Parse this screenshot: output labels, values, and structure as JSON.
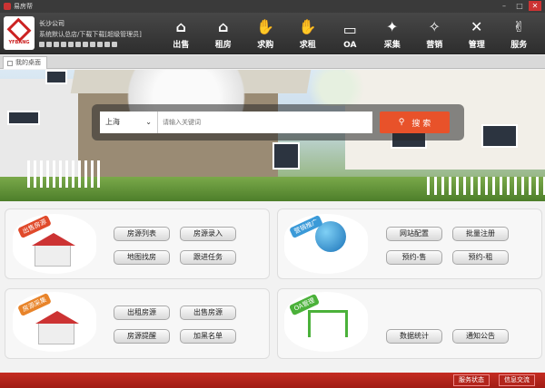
{
  "window": {
    "title": "易房帮",
    "controls": [
      "–",
      "□",
      "✕"
    ]
  },
  "brand": {
    "logo_text": "YFBANG"
  },
  "company": {
    "name": "长沙公司",
    "role": "系统默认总店/下载下载[超级管理员]"
  },
  "nav": [
    {
      "label": "出售",
      "icon": "sale-house-icon"
    },
    {
      "label": "租房",
      "icon": "rent-house-icon"
    },
    {
      "label": "求购",
      "icon": "buy-request-icon"
    },
    {
      "label": "求租",
      "icon": "rent-request-icon"
    },
    {
      "label": "OA",
      "icon": "folder-icon"
    },
    {
      "label": "采集",
      "icon": "magic-wand-icon"
    },
    {
      "label": "营销",
      "icon": "bird-icon"
    },
    {
      "label": "管理",
      "icon": "tools-icon"
    },
    {
      "label": "服务",
      "icon": "handshake-icon"
    }
  ],
  "tabs": [
    {
      "label": "我的桌面"
    }
  ],
  "search": {
    "city": "上海",
    "placeholder": "请输入关键词",
    "button": "搜 索"
  },
  "panels": {
    "sale": {
      "flag": "出售房源",
      "buttons": [
        "房源列表",
        "房源录入",
        "地图找房",
        "跟进任务"
      ]
    },
    "web": {
      "flag": "营销推广",
      "buttons": [
        "网站配置",
        "批量注册",
        "预约-售",
        "预约-租"
      ]
    },
    "collect": {
      "flag": "房源采集",
      "buttons": [
        "出租房源",
        "出售房源",
        "房源提醒",
        "加黑名单"
      ]
    },
    "oa": {
      "flag": "OA管理",
      "buttons": [
        "数据统计",
        "通知公告"
      ]
    }
  },
  "footer": {
    "service_status": "服务状态",
    "messages": "信息交流"
  }
}
